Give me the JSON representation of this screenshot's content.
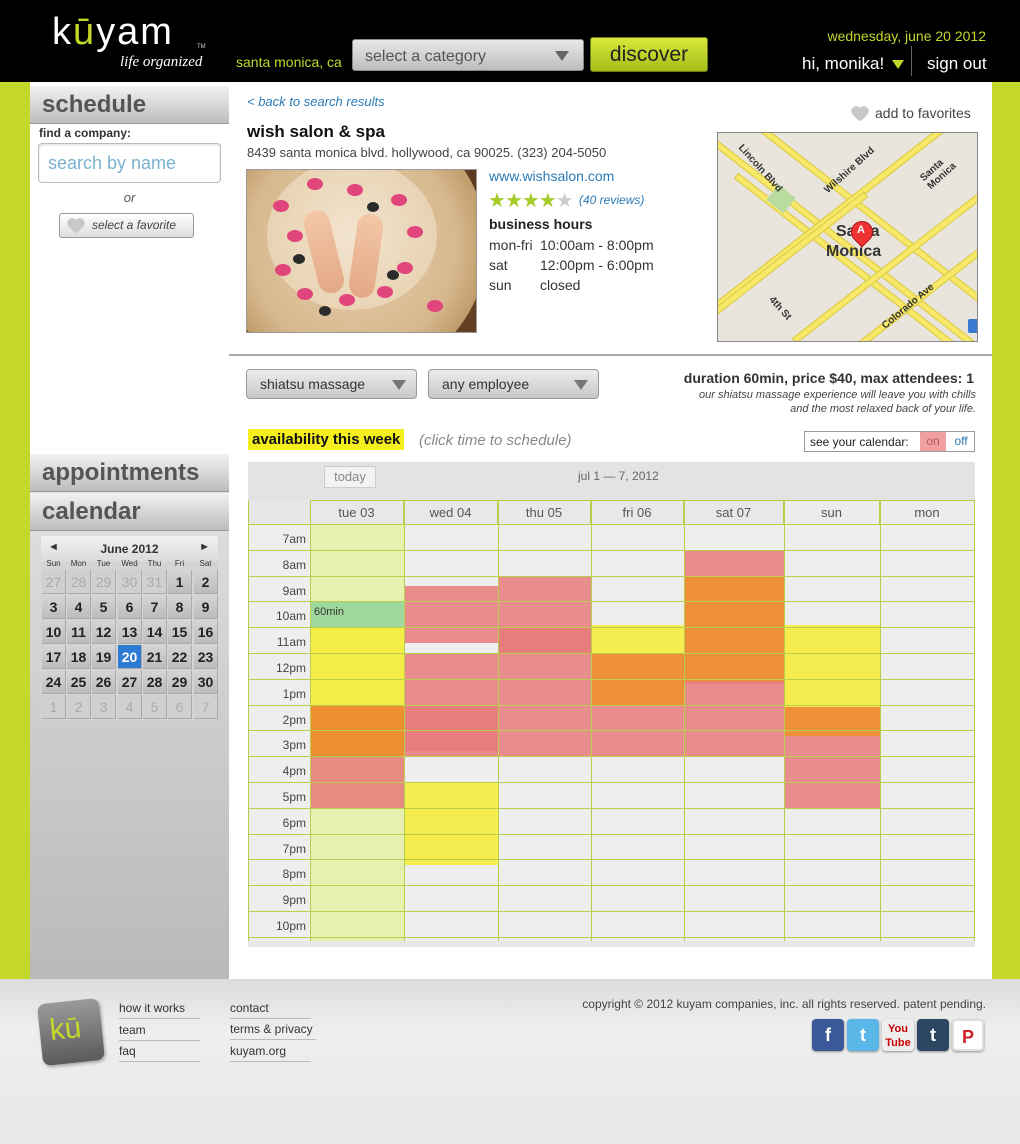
{
  "header": {
    "logo_text": "kūyam",
    "logo_tm": "TM",
    "logo_tagline": "life organized",
    "location": "santa monica, ca",
    "category_placeholder": "select a category",
    "discover_label": "discover",
    "date": "wednesday, june 20 2012",
    "greeting": "hi, monika!",
    "signout_label": "sign out"
  },
  "sidebar": {
    "schedule_title": "schedule",
    "find_label": "find a company:",
    "search_placeholder": "search by name",
    "or_label": "or",
    "favorite_label": "select a favorite",
    "appointments_title": "appointments",
    "calendar_title": "calendar",
    "calendar": {
      "month": "June 2012",
      "prev": "◄",
      "next": "►",
      "dow": [
        "Sun",
        "Mon",
        "Tue",
        "Wed",
        "Thu",
        "Fri",
        "Sat"
      ],
      "weeks": [
        [
          "27",
          "28",
          "29",
          "30",
          "31",
          "1",
          "2"
        ],
        [
          "3",
          "4",
          "5",
          "6",
          "7",
          "8",
          "9"
        ],
        [
          "10",
          "11",
          "12",
          "13",
          "14",
          "15",
          "16"
        ],
        [
          "17",
          "18",
          "19",
          "20",
          "21",
          "22",
          "23"
        ],
        [
          "24",
          "25",
          "26",
          "27",
          "28",
          "29",
          "30"
        ],
        [
          "1",
          "2",
          "3",
          "4",
          "5",
          "6",
          "7"
        ]
      ],
      "today": "20"
    }
  },
  "business": {
    "back_label": "< back to search results",
    "favorites_label": "add to favorites",
    "name": "wish salon & spa",
    "address": "8439 santa monica blvd. hollywood, ca 90025. (323) 204-5050",
    "website": "www.wishsalon.com",
    "rating": 4,
    "reviews_label": "(40 reviews)",
    "hours_title": "business hours",
    "hours": [
      {
        "day": "mon-fri",
        "time": "10:00am - 8:00pm"
      },
      {
        "day": "sat",
        "time": "12:00pm - 6:00pm"
      },
      {
        "day": "sun",
        "time": "closed"
      }
    ],
    "map_labels": {
      "lincoln": "Lincoln Blvd",
      "wilshire": "Wilshire Blvd",
      "santa_monica_road": "Santa Monica",
      "fourth": "4th St",
      "colorado": "Colorado Ave",
      "city_line1": "Santa",
      "city_line2": "Monica",
      "pin": "A"
    }
  },
  "service": {
    "service_select": "shiatsu massage",
    "employee_select": "any employee",
    "info": "duration 60min, price $40, max attendees: 1",
    "description": "our shiatsu massage experience will leave you with chills and the most relaxed back of your life."
  },
  "availability": {
    "title": "availability this week",
    "hint": "(click time to schedule)",
    "calendar_toggle_label": "see your calendar:",
    "toggle_on": "on",
    "toggle_off": "off",
    "today_label": "today",
    "week_range": "jul 1 — 7, 2012",
    "days": [
      "tue 03",
      "wed 04",
      "thu 05",
      "fri 06",
      "sat 07",
      "sun",
      "mon"
    ],
    "times": [
      "7am",
      "8am",
      "9am",
      "10am",
      "11am",
      "12pm",
      "1pm",
      "2pm",
      "3pm",
      "4pm",
      "5pm",
      "6pm",
      "7pm",
      "8pm",
      "9pm",
      "10pm"
    ],
    "selected_label": "60min",
    "colors": {
      "booked": "#e87a7a",
      "busy": "#ee8423",
      "open": "#f6ec32",
      "available": "#e8f0b0",
      "selected": "#9fd89b"
    }
  },
  "footer": {
    "links_col1": [
      "how it works",
      "team",
      "faq"
    ],
    "links_col2": [
      "contact",
      "terms & privacy",
      "kuyam.org"
    ],
    "copyright": "copyright © 2012 kuyam companies, inc. all rights reserved. patent pending.",
    "social": [
      "facebook-icon",
      "twitter-icon",
      "youtube-icon",
      "tumblr-icon",
      "pinterest-icon"
    ]
  }
}
